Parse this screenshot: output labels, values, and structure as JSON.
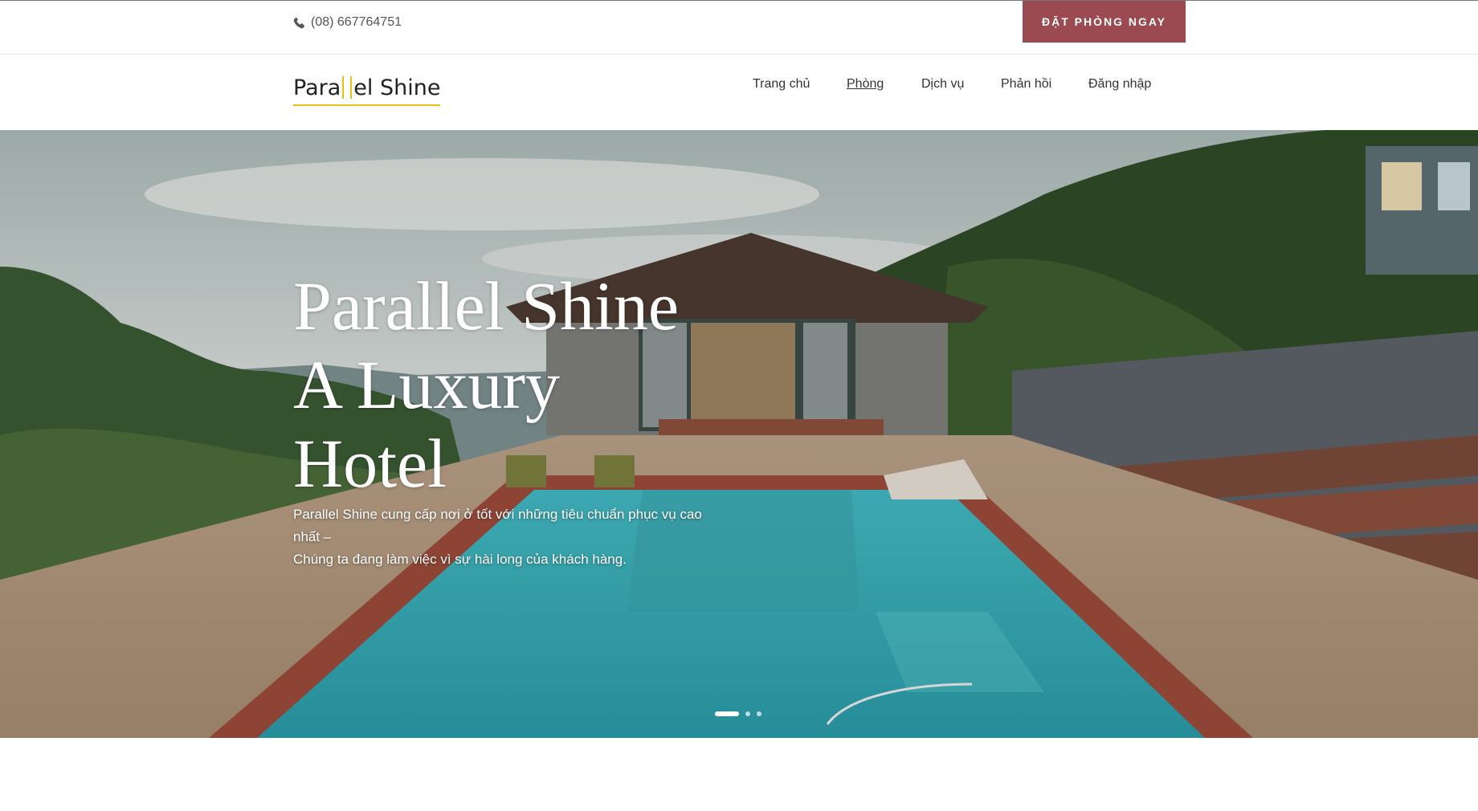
{
  "topbar": {
    "phone": "(08) 667764751",
    "phone_icon": "phone-icon",
    "book_button": "ĐẶT PHÒNG NGAY",
    "book_button_color": "#9a4a50"
  },
  "logo": {
    "part1": "Para",
    "part2": "el Shine",
    "accent_color": "#e3c21a"
  },
  "nav": {
    "items": [
      {
        "label": "Trang chủ"
      },
      {
        "label": "Phòng",
        "active": true
      },
      {
        "label": "Dịch vụ"
      },
      {
        "label": "Phản hồi"
      },
      {
        "label": "Đăng nhập"
      }
    ]
  },
  "hero": {
    "title_lines": [
      "Parallel Shine",
      "A Luxury",
      "Hotel"
    ],
    "desc_lines": [
      "Parallel Shine cung cấp nơi ở tốt với những tiêu chuẩn phục vụ cao",
      "nhất –",
      "Chúng ta đang làm việc vì sự hài long của khách hàng."
    ],
    "slides": 3,
    "active_slide": 1
  }
}
